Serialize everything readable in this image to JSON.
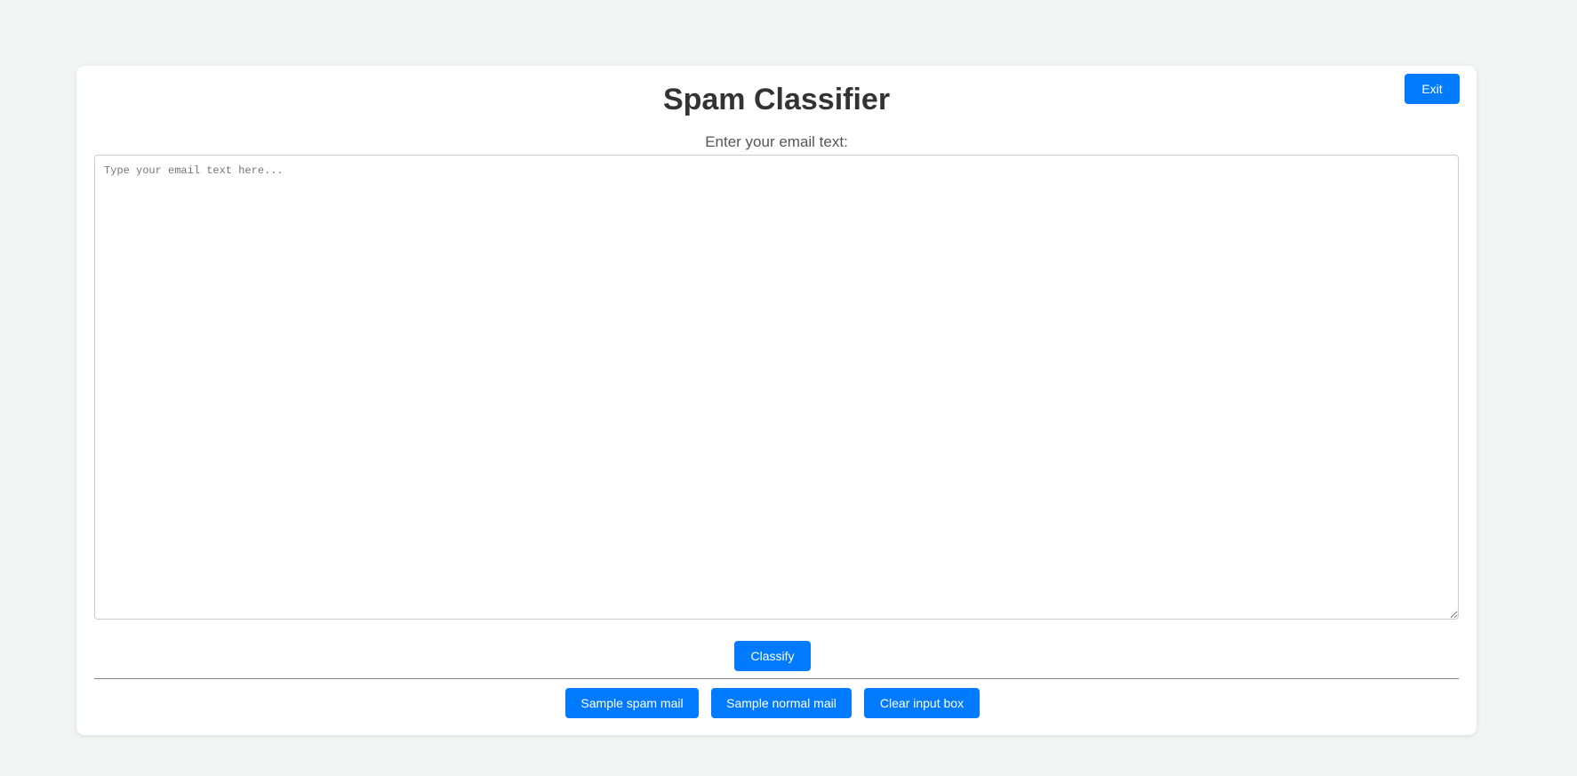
{
  "header": {
    "title": "Spam Classifier",
    "exit_label": "Exit"
  },
  "form": {
    "input_label": "Enter your email text:",
    "input_value": "",
    "input_placeholder": "Type your email text here...",
    "classify_label": "Classify"
  },
  "actions": {
    "sample_spam_label": "Sample spam mail",
    "sample_normal_label": "Sample normal mail",
    "clear_label": "Clear input box"
  },
  "colors": {
    "accent": "#007bff",
    "background": "#f2f3f3",
    "card": "#ffffff"
  }
}
